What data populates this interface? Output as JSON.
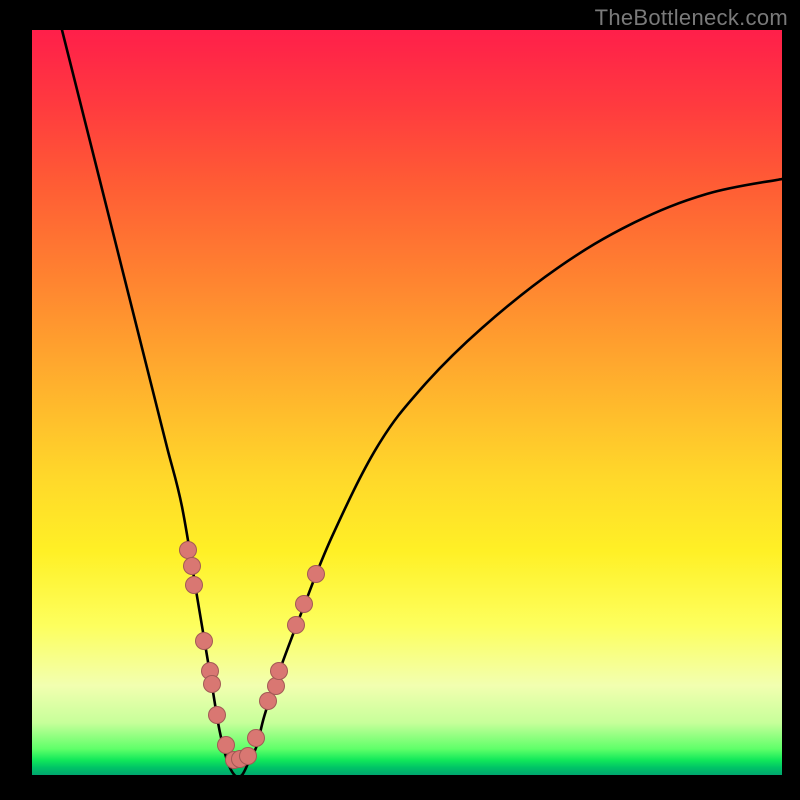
{
  "watermark": "TheBottleneck.com",
  "chart_data": {
    "type": "line",
    "title": "",
    "xlabel": "",
    "ylabel": "",
    "xlim": [
      0,
      100
    ],
    "ylim": [
      0,
      100
    ],
    "grid": false,
    "series": [
      {
        "name": "curve",
        "x": [
          4,
          6,
          8,
          10,
          12,
          14,
          16,
          18,
          20,
          22,
          23,
          24,
          25,
          26,
          27,
          28,
          29,
          30,
          31,
          33,
          36,
          40,
          46,
          52,
          60,
          70,
          80,
          90,
          100
        ],
        "y": [
          100,
          92,
          84,
          76,
          68,
          60,
          52,
          44,
          36,
          24,
          18,
          12,
          6,
          2,
          0,
          0,
          2,
          4,
          8,
          14,
          22,
          32,
          44,
          52,
          60,
          68,
          74,
          78,
          80
        ]
      }
    ],
    "scatter": {
      "name": "dots",
      "x": [
        20.8,
        21.3,
        21.6,
        22.9,
        23.7,
        24.0,
        24.7,
        25.9,
        26.9,
        27.7,
        28.8,
        29.9,
        31.5,
        32.5,
        32.9,
        35.2,
        36.3,
        37.9
      ],
      "y": [
        30.2,
        28.0,
        25.5,
        18.0,
        14.0,
        12.2,
        8.1,
        4.0,
        2.0,
        2.2,
        2.6,
        5.0,
        10.0,
        12.0,
        14.0,
        20.1,
        23.0,
        27.0
      ]
    },
    "colors": {
      "curve": "#000000",
      "dots": "#d97772",
      "gradient_top": "#ff1f4a",
      "gradient_mid": "#fff026",
      "gradient_bottom": "#00a66e"
    }
  }
}
